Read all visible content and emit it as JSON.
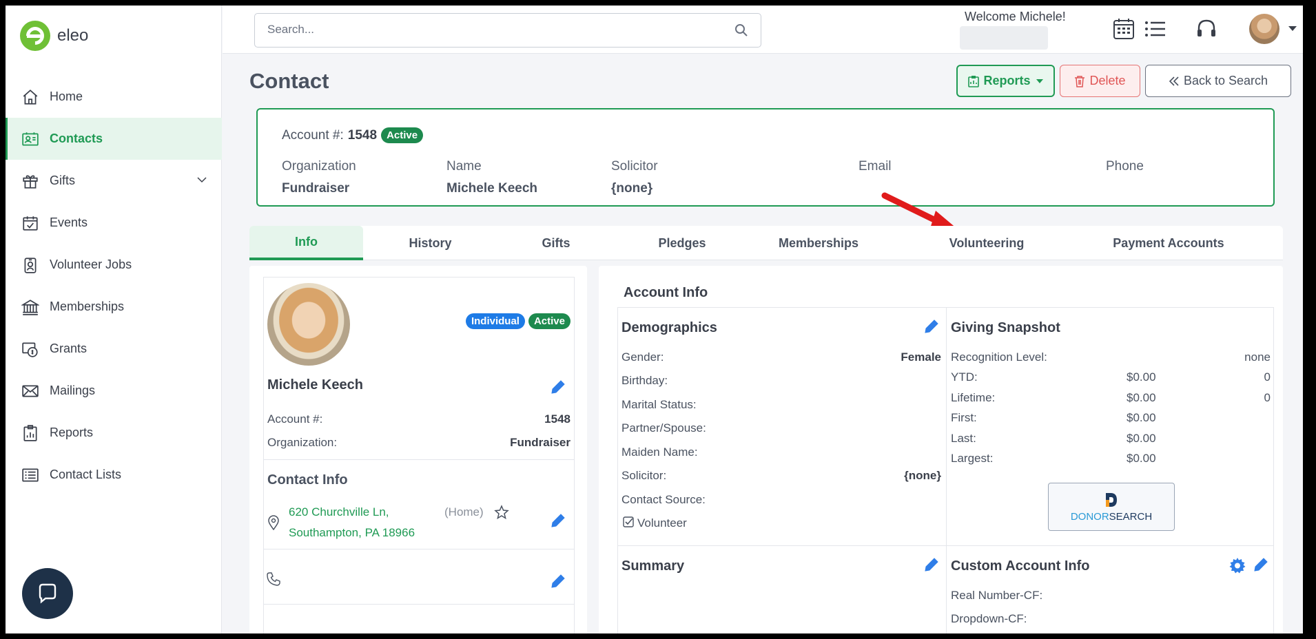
{
  "app": {
    "logo_text": "eleo"
  },
  "sidebar": {
    "items": [
      {
        "label": "Home",
        "icon": "home-icon"
      },
      {
        "label": "Contacts",
        "icon": "contacts-icon",
        "active": true
      },
      {
        "label": "Gifts",
        "icon": "gift-icon",
        "expandable": true
      },
      {
        "label": "Events",
        "icon": "calendar-check-icon"
      },
      {
        "label": "Volunteer Jobs",
        "icon": "badge-icon"
      },
      {
        "label": "Memberships",
        "icon": "building-icon"
      },
      {
        "label": "Grants",
        "icon": "grants-icon"
      },
      {
        "label": "Mailings",
        "icon": "envelope-icon"
      },
      {
        "label": "Reports",
        "icon": "report-icon"
      },
      {
        "label": "Contact Lists",
        "icon": "list-icon"
      }
    ]
  },
  "header": {
    "search_placeholder": "Search...",
    "welcome": "Welcome Michele!"
  },
  "page": {
    "title": "Contact",
    "buttons": {
      "reports": "Reports",
      "delete": "Delete",
      "back": "Back to Search"
    }
  },
  "account": {
    "account_label": "Account #:",
    "account_number": "1548",
    "status": "Active",
    "fields": [
      {
        "label": "Organization",
        "value": "Fundraiser"
      },
      {
        "label": "Name",
        "value": "Michele Keech"
      },
      {
        "label": "Solicitor",
        "value": "{none}"
      },
      {
        "label": "Email",
        "value": ""
      },
      {
        "label": "Phone",
        "value": ""
      }
    ]
  },
  "tabs": [
    {
      "label": "Info",
      "active": true
    },
    {
      "label": "History"
    },
    {
      "label": "Gifts"
    },
    {
      "label": "Pledges"
    },
    {
      "label": "Memberships"
    },
    {
      "label": "Volunteering"
    },
    {
      "label": "Payment Accounts"
    }
  ],
  "profile": {
    "type_badge": "Individual",
    "status_badge": "Active",
    "name": "Michele Keech",
    "account_label": "Account #:",
    "account_value": "1548",
    "org_label": "Organization:",
    "org_value": "Fundraiser",
    "contact_info_title": "Contact Info",
    "address_line1": "620 Churchville Ln,",
    "address_line2": "Southampton, PA 18966",
    "address_type": "(Home)"
  },
  "account_info": {
    "title": "Account Info",
    "demographics": {
      "title": "Demographics",
      "rows": [
        {
          "label": "Gender:",
          "value": "Female"
        },
        {
          "label": "Birthday:",
          "value": ""
        },
        {
          "label": "Marital Status:",
          "value": ""
        },
        {
          "label": "Partner/Spouse:",
          "value": ""
        },
        {
          "label": "Maiden Name:",
          "value": ""
        },
        {
          "label": "Solicitor:",
          "value": "{none}"
        },
        {
          "label": "Contact Source:",
          "value": ""
        }
      ],
      "volunteer_label": "Volunteer",
      "volunteer_checked": true
    },
    "giving": {
      "title": "Giving Snapshot",
      "recognition_label": "Recognition Level:",
      "recognition_value": "none",
      "rows": [
        {
          "label": "YTD:",
          "amount": "$0.00",
          "count": "0"
        },
        {
          "label": "Lifetime:",
          "amount": "$0.00",
          "count": "0"
        },
        {
          "label": "First:",
          "amount": "$0.00",
          "count": ""
        },
        {
          "label": "Last:",
          "amount": "$0.00",
          "count": ""
        },
        {
          "label": "Largest:",
          "amount": "$0.00",
          "count": ""
        }
      ],
      "donorsearch_a": "DONOR",
      "donorsearch_b": "SEARCH"
    },
    "summary_title": "Summary",
    "custom": {
      "title": "Custom Account Info",
      "rows": [
        {
          "label": "Real Number-CF:"
        },
        {
          "label": "Dropdown-CF:"
        }
      ]
    }
  },
  "colors": {
    "brand": "#1f9a54",
    "accent_blue": "#1e7be6",
    "danger": "#e05555",
    "arrow": "#e01b1b"
  }
}
